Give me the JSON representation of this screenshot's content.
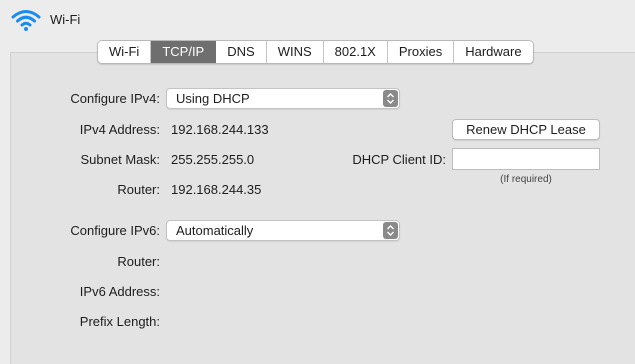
{
  "header": {
    "title": "Wi-Fi",
    "icon": "wifi-icon"
  },
  "tabs": [
    {
      "label": "Wi-Fi"
    },
    {
      "label": "TCP/IP"
    },
    {
      "label": "DNS"
    },
    {
      "label": "WINS"
    },
    {
      "label": "802.1X"
    },
    {
      "label": "Proxies"
    },
    {
      "label": "Hardware"
    }
  ],
  "active_tab": "TCP/IP",
  "ipv4": {
    "configure_label": "Configure IPv4:",
    "configure_value": "Using DHCP",
    "address_label": "IPv4 Address:",
    "address_value": "192.168.244.133",
    "subnet_label": "Subnet Mask:",
    "subnet_value": "255.255.255.0",
    "router_label": "Router:",
    "router_value": "192.168.244.35",
    "renew_button": "Renew DHCP Lease",
    "client_id_label": "DHCP Client ID:",
    "client_id_value": "",
    "client_id_hint": "(If required)"
  },
  "ipv6": {
    "configure_label": "Configure IPv6:",
    "configure_value": "Automatically",
    "router_label": "Router:",
    "address_label": "IPv6 Address:",
    "prefix_label": "Prefix Length:"
  },
  "colors": {
    "active_tab_bg": "#6f6f6f",
    "wifi_icon": "#1a8cf0",
    "panel_bg": "#e3e3e3"
  }
}
